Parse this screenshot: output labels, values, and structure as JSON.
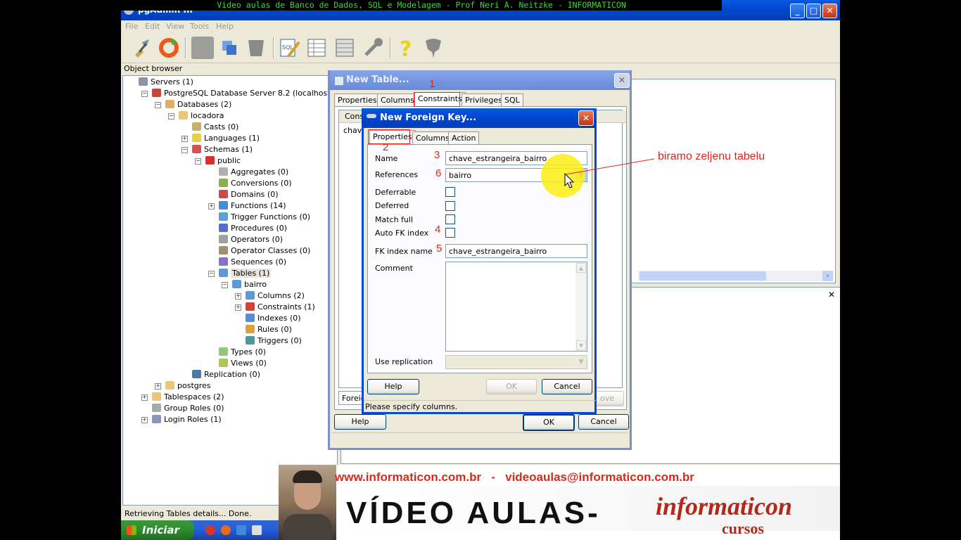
{
  "video_caption": "Video aulas de Banco de Dados, SQL e Modelagem - Prof Neri A. Neitzke - INFORMATICON",
  "window": {
    "title": "pgAdmin III",
    "minimize": "_",
    "maximize": "□",
    "close": "✕"
  },
  "menu": [
    "File",
    "Edit",
    "View",
    "Tools",
    "Help"
  ],
  "toolbar_icons": [
    "connect-icon",
    "refresh-icon",
    "create-icon",
    "drop-icon",
    "properties-icon",
    "sql-icon",
    "view-data-icon",
    "filtered-data-icon",
    "maintenance-icon",
    "help-icon",
    "tip-icon"
  ],
  "object_browser": {
    "header": "Object browser",
    "tree": [
      {
        "label": "Servers (1)"
      },
      {
        "label": "PostgreSQL Database Server 8.2 (localhost:5432)"
      },
      {
        "label": "Databases (2)"
      },
      {
        "label": "locadora"
      },
      {
        "label": "Casts (0)"
      },
      {
        "label": "Languages (1)"
      },
      {
        "label": "Schemas (1)"
      },
      {
        "label": "public"
      },
      {
        "label": "Aggregates (0)"
      },
      {
        "label": "Conversions (0)"
      },
      {
        "label": "Domains (0)"
      },
      {
        "label": "Functions (14)"
      },
      {
        "label": "Trigger Functions (0)"
      },
      {
        "label": "Procedures (0)"
      },
      {
        "label": "Operators (0)"
      },
      {
        "label": "Operator Classes (0)"
      },
      {
        "label": "Sequences (0)"
      },
      {
        "label": "Tables (1)"
      },
      {
        "label": "bairro"
      },
      {
        "label": "Columns (2)"
      },
      {
        "label": "Constraints (1)"
      },
      {
        "label": "Indexes (0)"
      },
      {
        "label": "Rules (0)"
      },
      {
        "label": "Triggers (0)"
      },
      {
        "label": "Types (0)"
      },
      {
        "label": "Views (0)"
      },
      {
        "label": "Replication (0)"
      },
      {
        "label": "postgres"
      },
      {
        "label": "Tablespaces (2)"
      },
      {
        "label": "Group Roles (0)"
      },
      {
        "label": "Login Roles (1)"
      }
    ]
  },
  "status_text": "Retrieving Tables details... Done.",
  "sql_pane_close": "✕",
  "new_table_dialog": {
    "title": "New Table...",
    "close": "✕",
    "tabs": [
      "Properties",
      "Columns",
      "Constraints",
      "Privileges",
      "SQL"
    ],
    "active_tab": "Constraints",
    "list_header": "Cons",
    "list_item": "chave",
    "type_combo": "Foreign",
    "remove_button": "ove",
    "help_button": "Help",
    "ok_button": "OK",
    "cancel_button": "Cancel"
  },
  "foreign_key_dialog": {
    "title": "New Foreign Key...",
    "close": "✕",
    "tabs": [
      "Properties",
      "Columns",
      "Action"
    ],
    "active_tab": "Properties",
    "fields": {
      "name_label": "Name",
      "name_value": "chave_estrangeira_bairro",
      "references_label": "References",
      "references_value": "bairro",
      "deferrable_label": "Deferrable",
      "deferred_label": "Deferred",
      "match_full_label": "Match full",
      "auto_fk_index_label": "Auto FK index",
      "fk_index_name_label": "FK index name",
      "fk_index_name_value": "chave_estrangeira_bairro",
      "comment_label": "Comment",
      "comment_value": "",
      "use_replication_label": "Use replication"
    },
    "help_button": "Help",
    "ok_button": "OK",
    "cancel_button": "Cancel",
    "status": "Please specify columns."
  },
  "annotations": {
    "n1": "1",
    "n2": "2",
    "n3": "3",
    "n4": "4",
    "n5": "5",
    "n6": "6",
    "callout": "biramo zeljenu tabelu",
    "color": "#e2231a"
  },
  "taskbar": {
    "start_label": "Iniciar"
  },
  "banner": {
    "urls": "www.informaticon.com.br   -   videoaulas@informaticon.com.br",
    "video_text": "VÍDEO AULAS-",
    "brand": "informaticon",
    "sub": "cursos"
  }
}
